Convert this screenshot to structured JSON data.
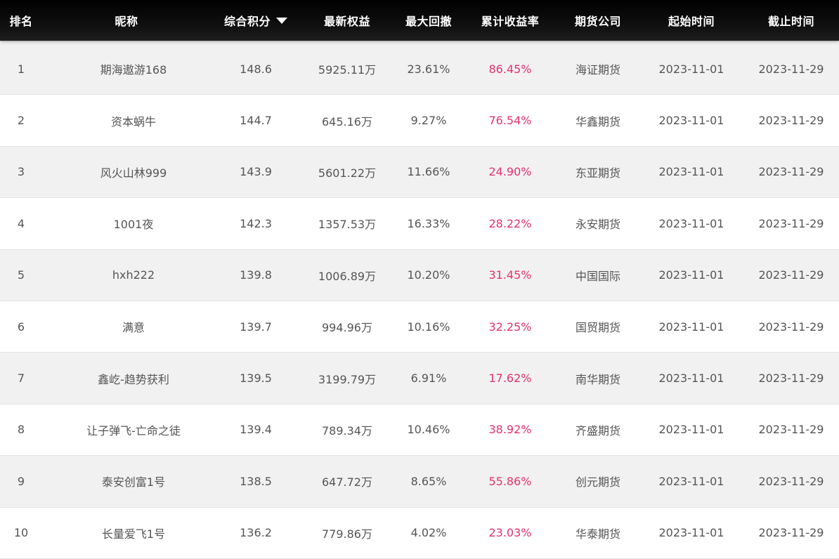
{
  "columns": {
    "rank": "排名",
    "nickname": "昵称",
    "score": "综合积分",
    "equity": "最新权益",
    "drawdown": "最大回撤",
    "return": "累计收益率",
    "company": "期货公司",
    "start": "起始时间",
    "end": "截止时间"
  },
  "sort": {
    "column": "score",
    "direction": "descending",
    "icon": "triangle-down-icon"
  },
  "colors": {
    "header_bg": "#000000",
    "return_text": "#e5306f",
    "stripe": "#f1f1f1"
  },
  "rows": [
    {
      "rank": "1",
      "nickname": "期海遨游168",
      "score": "148.6",
      "equity": "5925.11万",
      "drawdown": "23.61%",
      "return": "86.45%",
      "company": "海证期货",
      "start": "2023-11-01",
      "end": "2023-11-29"
    },
    {
      "rank": "2",
      "nickname": "资本蜗牛",
      "score": "144.7",
      "equity": "645.16万",
      "drawdown": "9.27%",
      "return": "76.54%",
      "company": "华鑫期货",
      "start": "2023-11-01",
      "end": "2023-11-29"
    },
    {
      "rank": "3",
      "nickname": "风火山林999",
      "score": "143.9",
      "equity": "5601.22万",
      "drawdown": "11.66%",
      "return": "24.90%",
      "company": "东亚期货",
      "start": "2023-11-01",
      "end": "2023-11-29"
    },
    {
      "rank": "4",
      "nickname": "1001夜",
      "score": "142.3",
      "equity": "1357.53万",
      "drawdown": "16.33%",
      "return": "28.22%",
      "company": "永安期货",
      "start": "2023-11-01",
      "end": "2023-11-29"
    },
    {
      "rank": "5",
      "nickname": "hxh222",
      "score": "139.8",
      "equity": "1006.89万",
      "drawdown": "10.20%",
      "return": "31.45%",
      "company": "中国国际",
      "start": "2023-11-01",
      "end": "2023-11-29"
    },
    {
      "rank": "6",
      "nickname": "满意",
      "score": "139.7",
      "equity": "994.96万",
      "drawdown": "10.16%",
      "return": "32.25%",
      "company": "国贸期货",
      "start": "2023-11-01",
      "end": "2023-11-29"
    },
    {
      "rank": "7",
      "nickname": "鑫屹-趋势获利",
      "score": "139.5",
      "equity": "3199.79万",
      "drawdown": "6.91%",
      "return": "17.62%",
      "company": "南华期货",
      "start": "2023-11-01",
      "end": "2023-11-29"
    },
    {
      "rank": "8",
      "nickname": "让子弹飞-亡命之徒",
      "score": "139.4",
      "equity": "789.34万",
      "drawdown": "10.46%",
      "return": "38.92%",
      "company": "齐盛期货",
      "start": "2023-11-01",
      "end": "2023-11-29"
    },
    {
      "rank": "9",
      "nickname": "泰安创富1号",
      "score": "138.5",
      "equity": "647.72万",
      "drawdown": "8.65%",
      "return": "55.86%",
      "company": "创元期货",
      "start": "2023-11-01",
      "end": "2023-11-29"
    },
    {
      "rank": "10",
      "nickname": "长量爱飞1号",
      "score": "136.2",
      "equity": "779.86万",
      "drawdown": "4.02%",
      "return": "23.03%",
      "company": "华泰期货",
      "start": "2023-11-01",
      "end": "2023-11-29"
    }
  ]
}
